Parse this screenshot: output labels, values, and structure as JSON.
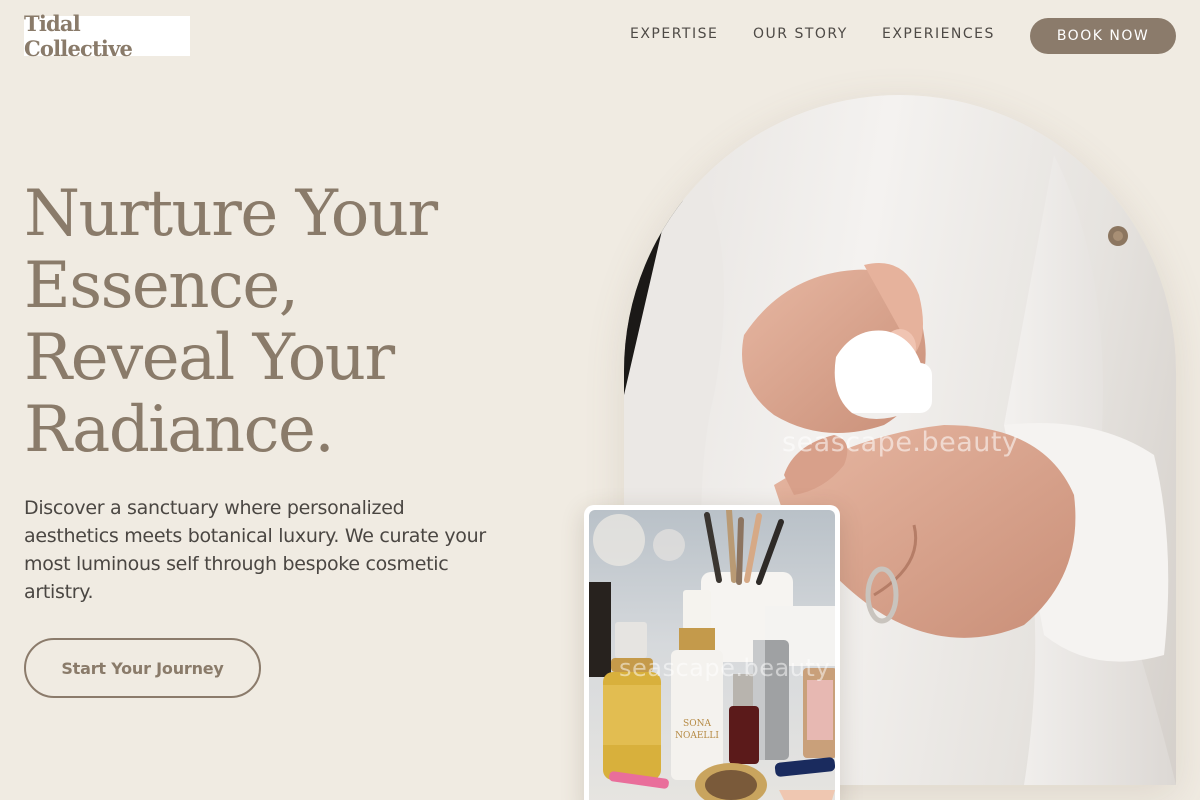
{
  "brand": {
    "name": "Tidal Collective"
  },
  "nav": {
    "links": [
      "EXPERTISE",
      "OUR STORY",
      "EXPERIENCES"
    ],
    "book_label": "BOOK NOW"
  },
  "hero": {
    "title_lines": [
      "Nurture Your",
      "Essence,",
      "Reveal Your",
      "Radiance."
    ],
    "description": "Discover a sanctuary where personalized aesthetics meets botanical luxury. We curate your most luminous self through bespoke cosmetic artistry.",
    "cta_label": "Start Your Journey"
  },
  "images": {
    "main_watermark": "seascape.beauty",
    "product_watermark": "seascape.beauty",
    "serum_bottle_label": "SONA\nNOAELLI"
  },
  "colors": {
    "background": "#f0ebe2",
    "accent": "#8b7b6b",
    "heading": "#8a7b6a",
    "body_text": "#4a4642"
  }
}
